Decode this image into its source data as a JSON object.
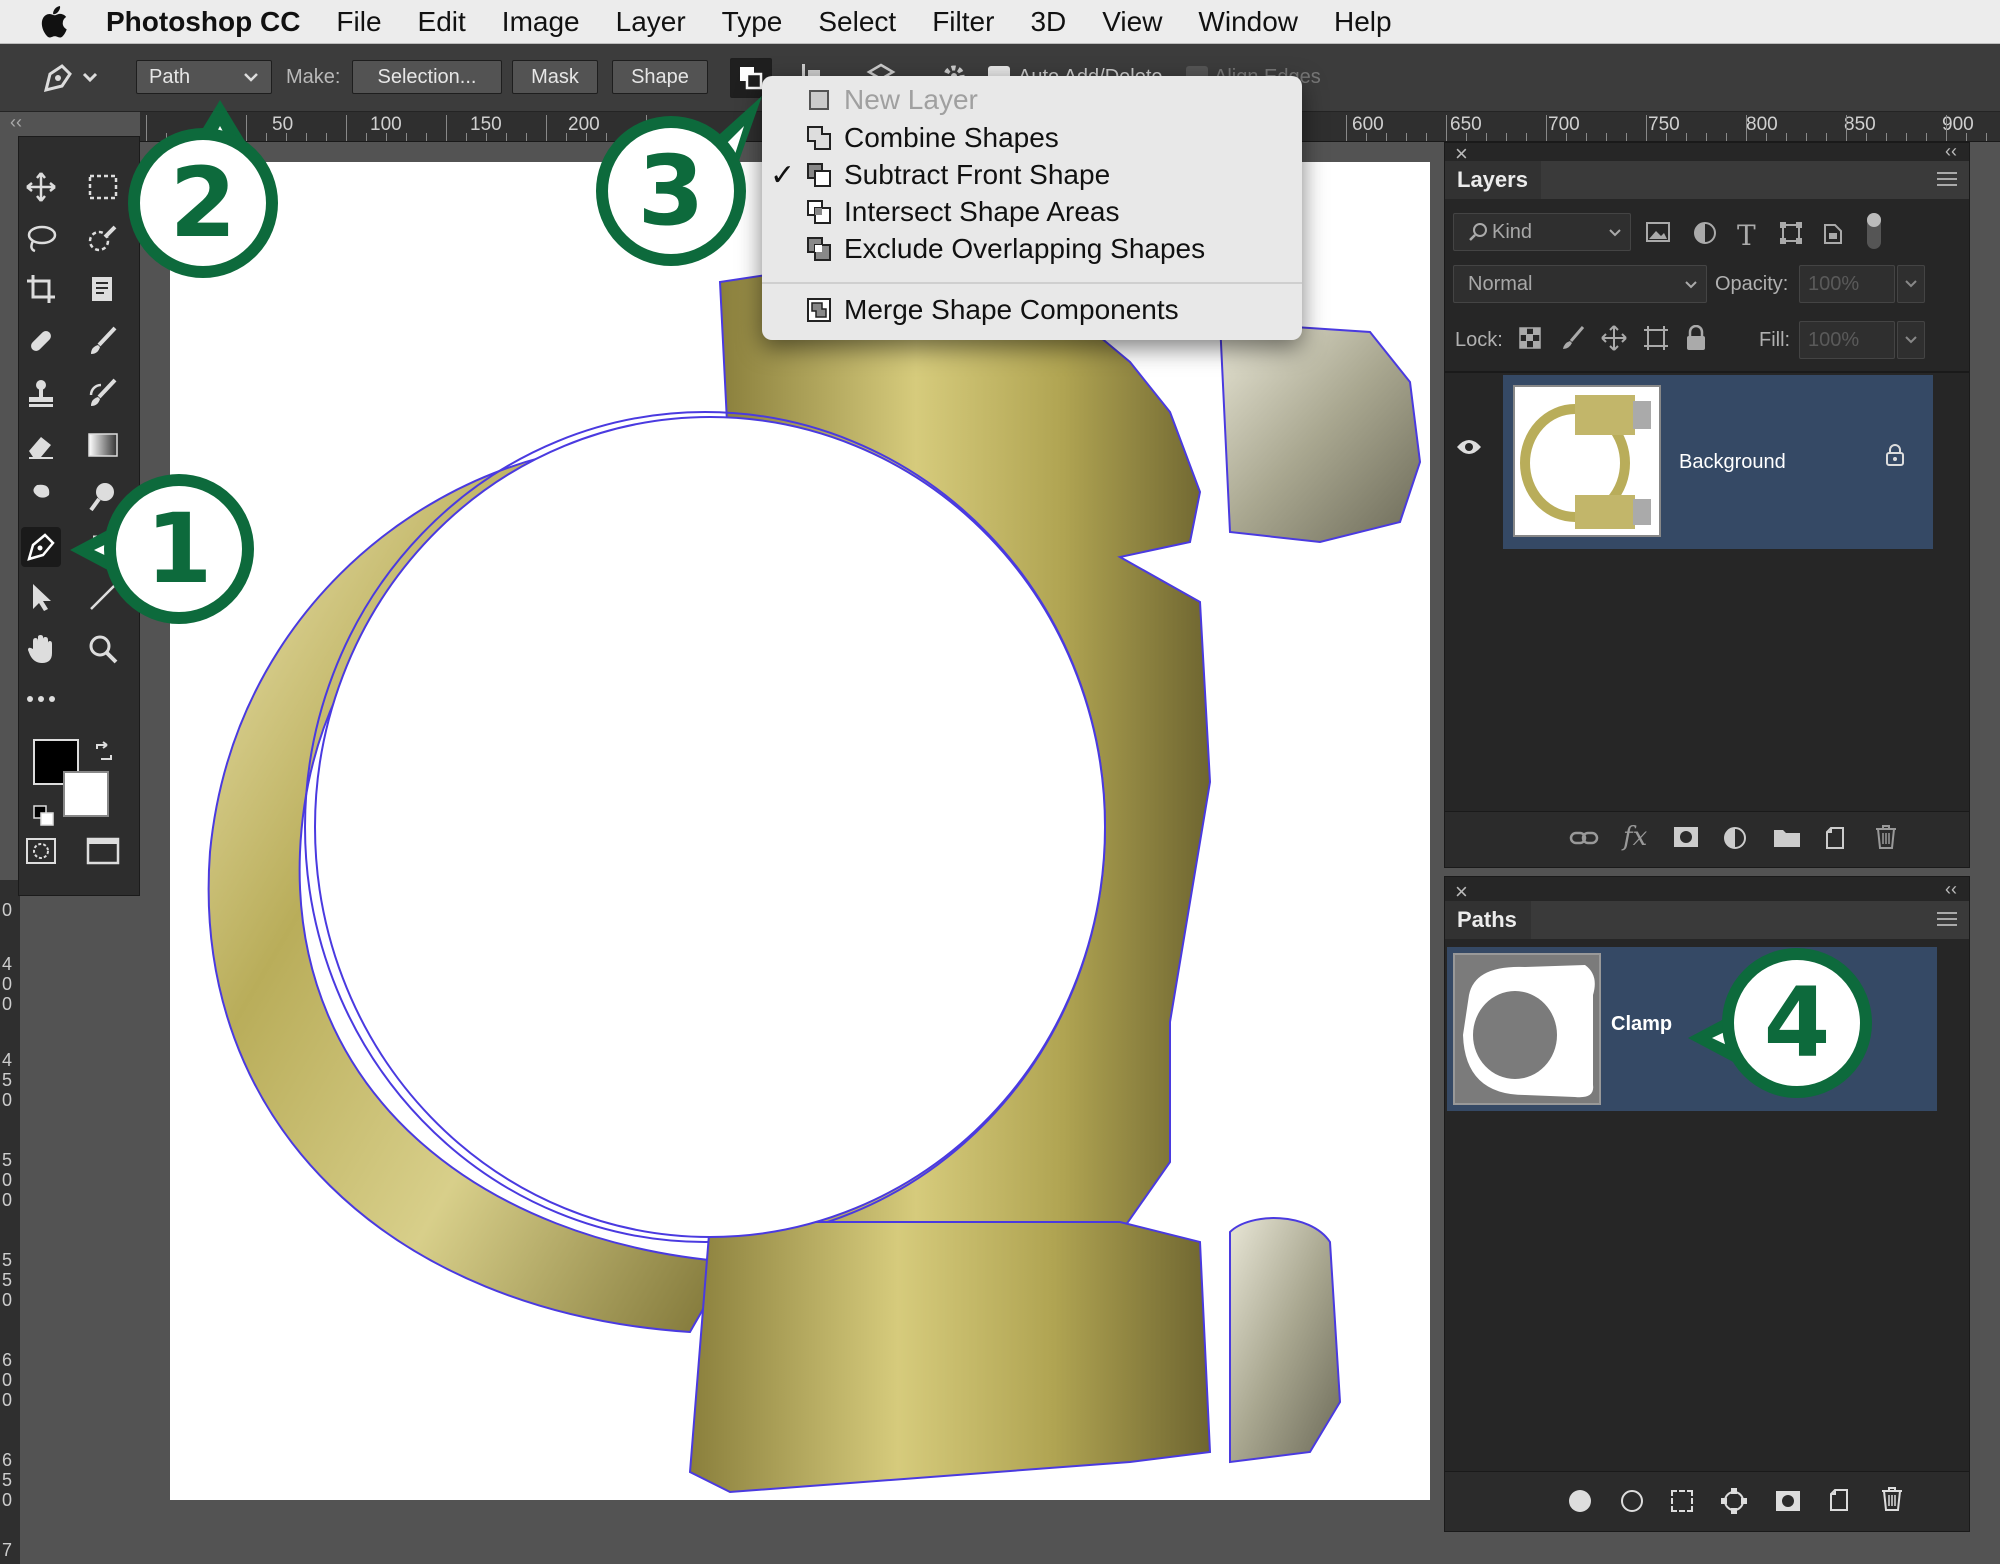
{
  "menubar": {
    "app_name": "Photoshop CC",
    "items": [
      "File",
      "Edit",
      "Image",
      "Layer",
      "Type",
      "Select",
      "Filter",
      "3D",
      "View",
      "Window",
      "Help"
    ]
  },
  "options_bar": {
    "mode_select": "Path",
    "make_label": "Make:",
    "selection_button": "Selection...",
    "mask_button": "Mask",
    "shape_button": "Shape",
    "auto_add_delete": "Auto Add/Delete",
    "align_edges": "Align Edges"
  },
  "ruler": {
    "ticks": [
      "50",
      "100",
      "150",
      "200",
      "600",
      "650",
      "700",
      "750",
      "800",
      "850",
      "900"
    ]
  },
  "vruler": [
    "0",
    "4",
    "0",
    "0",
    "4",
    "5",
    "0",
    "5",
    "0",
    "0",
    "5",
    "5",
    "0",
    "6",
    "0",
    "0",
    "6",
    "5",
    "0",
    "7"
  ],
  "path_ops_menu": {
    "items": [
      {
        "label": "New Layer",
        "disabled": true,
        "checked": false
      },
      {
        "label": "Combine Shapes",
        "disabled": false,
        "checked": false
      },
      {
        "label": "Subtract Front Shape",
        "disabled": false,
        "checked": true
      },
      {
        "label": "Intersect Shape Areas",
        "disabled": false,
        "checked": false
      },
      {
        "label": "Exclude Overlapping Shapes",
        "disabled": false,
        "checked": false
      }
    ],
    "merge": "Merge Shape Components",
    "check_glyph": "✓"
  },
  "layers_panel": {
    "tab": "Layers",
    "filter_kind": "Kind",
    "blend_mode": "Normal",
    "opacity_label": "Opacity:",
    "opacity_value": "100%",
    "lock_label": "Lock:",
    "fill_label": "Fill:",
    "fill_value": "100%",
    "layers": [
      {
        "name": "Background"
      }
    ]
  },
  "paths_panel": {
    "tab": "Paths",
    "paths": [
      {
        "name": "Clamp"
      }
    ]
  },
  "callouts": [
    "1",
    "2",
    "3",
    "4"
  ],
  "colors": {
    "callout_green": "#0d6a3c",
    "selection_blue": "#354965",
    "path_outline": "#4a3ae0"
  }
}
